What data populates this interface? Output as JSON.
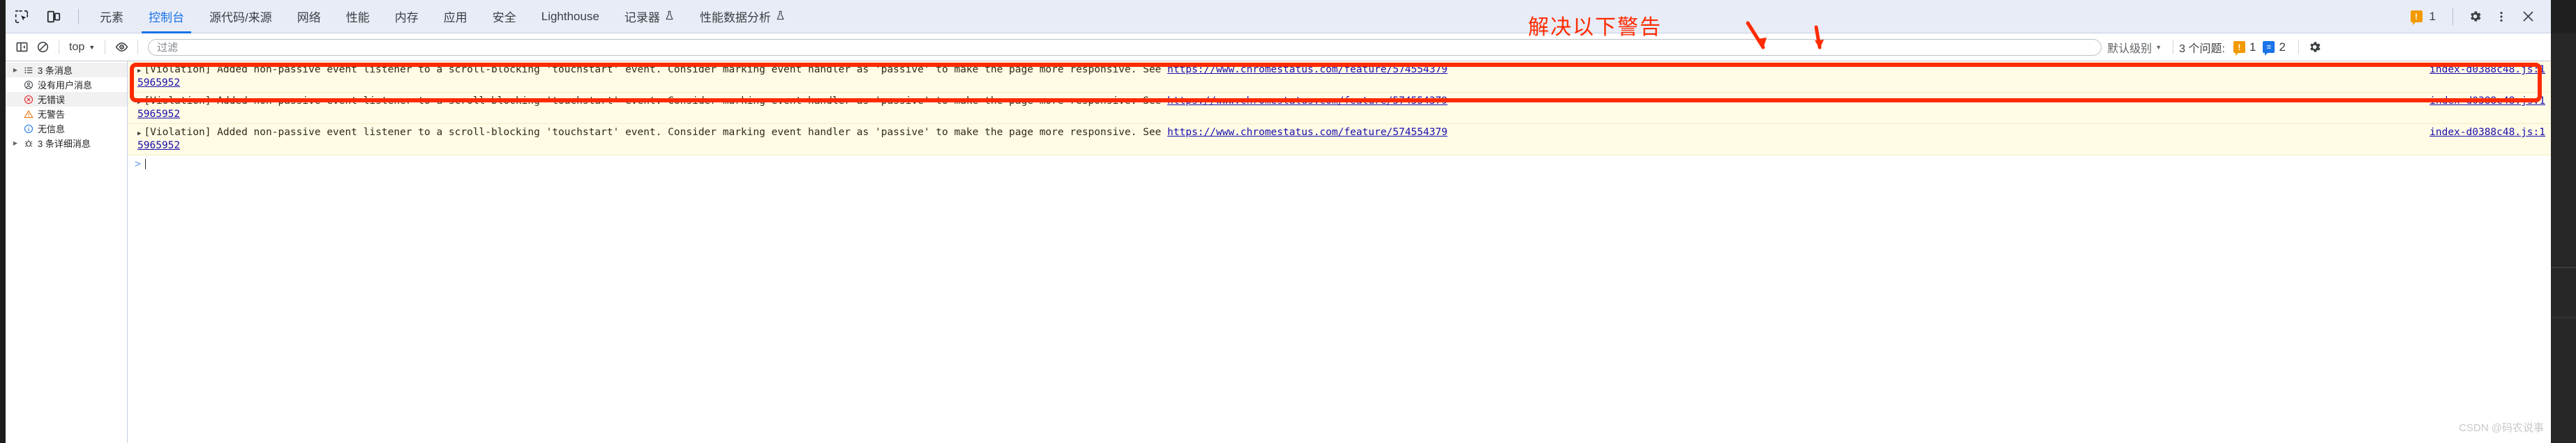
{
  "tabbar": {
    "inspect_icon": "inspect-element-icon",
    "device_icon": "device-toolbar-icon",
    "tabs": [
      {
        "label": "元素",
        "name": "tab-elements",
        "active": false,
        "flask": false
      },
      {
        "label": "控制台",
        "name": "tab-console",
        "active": true,
        "flask": false
      },
      {
        "label": "源代码/来源",
        "name": "tab-sources",
        "active": false,
        "flask": false
      },
      {
        "label": "网络",
        "name": "tab-network",
        "active": false,
        "flask": false
      },
      {
        "label": "性能",
        "name": "tab-performance",
        "active": false,
        "flask": false
      },
      {
        "label": "内存",
        "name": "tab-memory",
        "active": false,
        "flask": false
      },
      {
        "label": "应用",
        "name": "tab-application",
        "active": false,
        "flask": false
      },
      {
        "label": "安全",
        "name": "tab-security",
        "active": false,
        "flask": false
      },
      {
        "label": "Lighthouse",
        "name": "tab-lighthouse",
        "active": false,
        "flask": false
      },
      {
        "label": "记录器",
        "name": "tab-recorder",
        "active": false,
        "flask": true
      },
      {
        "label": "性能数据分析",
        "name": "tab-performance-insights",
        "active": false,
        "flask": true
      }
    ],
    "warning_badge_glyph": "!",
    "warning_count": "1",
    "settings_icon": "gear-icon",
    "more_icon": "kebab-menu-icon",
    "close_icon": "close-icon"
  },
  "console_toolbar": {
    "sidebar_toggle_icon": "console-sidebar-toggle-icon",
    "clear_icon": "clear-console-icon",
    "context_label": "top",
    "eye_icon": "live-expression-eye-icon",
    "filter_placeholder": "过滤",
    "filter_value": "",
    "level_label": "默认级别",
    "issues_label": "3 个问题:",
    "issues_warning_glyph": "!",
    "issues_warning_count": "1",
    "issues_info_glyph": "≡",
    "issues_info_count": "2",
    "settings_icon": "console-settings-gear-icon"
  },
  "sidebar": {
    "items": [
      {
        "label": "3 条消息",
        "icon": "message-list-icon",
        "name": "sidebar-item-messages",
        "expandable": true,
        "shaded": true
      },
      {
        "label": "没有用户消息",
        "icon": "user-message-icon",
        "name": "sidebar-item-user-messages",
        "expandable": false,
        "shaded": false
      },
      {
        "label": "无错误",
        "icon": "error-circle-icon",
        "name": "sidebar-item-errors",
        "expandable": false,
        "shaded": true
      },
      {
        "label": "无警告",
        "icon": "warning-triangle-icon",
        "name": "sidebar-item-warnings",
        "expandable": false,
        "shaded": false
      },
      {
        "label": "无信息",
        "icon": "info-circle-icon",
        "name": "sidebar-item-info",
        "expandable": false,
        "shaded": false
      },
      {
        "label": "3 条详细消息",
        "icon": "bug-verbose-icon",
        "name": "sidebar-item-verbose",
        "expandable": true,
        "shaded": false
      }
    ]
  },
  "console": {
    "messages": [
      {
        "expand_glyph": "▶",
        "text": "[Violation] Added non-passive event listener to a scroll-blocking 'touchstart' event. Consider marking event handler as 'passive' to make the page more responsive. See ",
        "link": "https://www.chromestatus.com/feature/574554379",
        "source": "index-d0388c48.js:1",
        "wrap": "5965952",
        "highlighted": true
      },
      {
        "expand_glyph": "▶",
        "text": "[Violation] Added non-passive event listener to a scroll-blocking 'touchstart' event. Consider marking event handler as 'passive' to make the page more responsive. See ",
        "link": "https://www.chromestatus.com/feature/574554379",
        "source": "index-d0388c48.js:1",
        "wrap": "5965952",
        "highlighted": false
      },
      {
        "expand_glyph": "▶",
        "text": "[Violation] Added non-passive event listener to a scroll-blocking 'touchstart' event. Consider marking event handler as 'passive' to make the page more responsive. See ",
        "link": "https://www.chromestatus.com/feature/574554379",
        "source": "index-d0388c48.js:1",
        "wrap": "5965952",
        "highlighted": false
      }
    ],
    "prompt_glyph": ">",
    "prompt_value": ""
  },
  "annotation": {
    "text": "解决以下警告",
    "color": "#fe2b00"
  },
  "watermark": {
    "text": "CSDN @码农说事"
  },
  "colors": {
    "accent": "#1a73e8",
    "tabbar_bg": "#e8ecf7",
    "warning_row_bg": "#fffbe5",
    "warning_badge": "#f29900",
    "annotation_red": "#fe2b00",
    "link": "#1a0dab"
  }
}
